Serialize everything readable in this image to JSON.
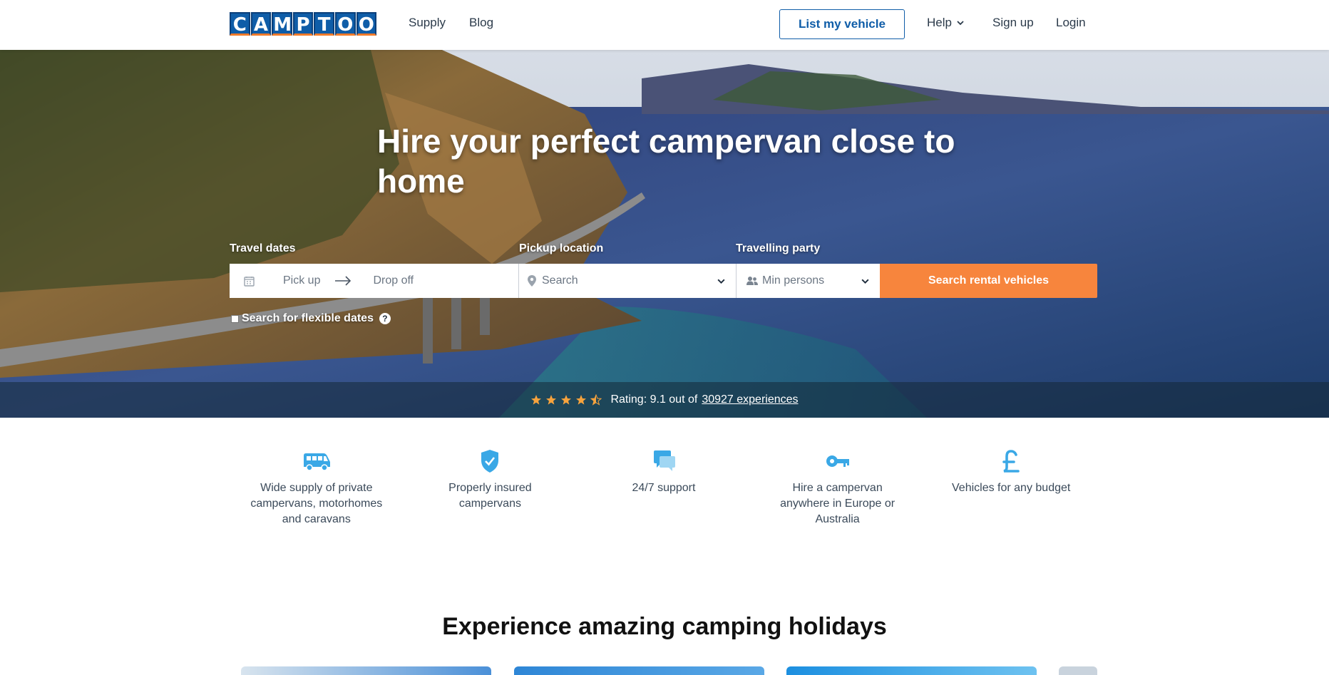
{
  "header": {
    "logo_text": "CAMPTOO",
    "nav": {
      "supply": "Supply",
      "blog": "Blog"
    },
    "list_vehicle": "List my vehicle",
    "help": "Help",
    "signup": "Sign up",
    "login": "Login"
  },
  "hero": {
    "title": "Hire your perfect campervan close to home",
    "labels": {
      "dates": "Travel dates",
      "location": "Pickup location",
      "party": "Travelling party"
    },
    "pickup_placeholder": "Pick up",
    "dropoff_placeholder": "Drop off",
    "location_placeholder": "Search",
    "party_placeholder": "Min persons",
    "search_button": "Search rental vehicles",
    "flexible_dates": "Search for flexible dates",
    "flexible_help": "?",
    "rating_stars": 4.5,
    "rating_text": "Rating: 9.1 out of",
    "rating_link": "30927 experiences"
  },
  "usps": [
    {
      "icon": "van-icon",
      "text": "Wide supply of private campervans, motorhomes and caravans"
    },
    {
      "icon": "shield-check-icon",
      "text": "Properly insured campervans"
    },
    {
      "icon": "chat-icon",
      "text": "24/7 support"
    },
    {
      "icon": "key-icon",
      "text": "Hire a campervan anywhere in Europe or Australia"
    },
    {
      "icon": "pound-icon",
      "text": "Vehicles for any budget"
    }
  ],
  "section_title": "Experience amazing camping holidays",
  "colors": {
    "brand": "#0f5da8",
    "accent": "#f7853d",
    "icon": "#3aa8e6"
  }
}
